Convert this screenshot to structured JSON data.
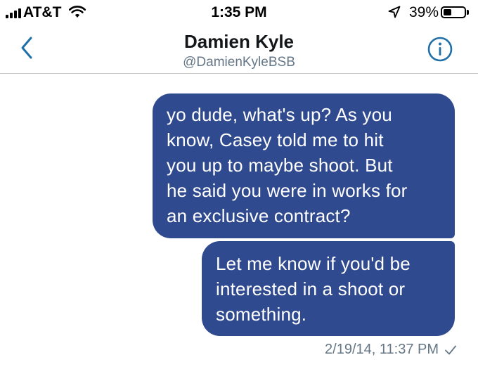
{
  "status_bar": {
    "carrier": "AT&T",
    "time": "1:35 PM",
    "battery_percent": "39%",
    "battery_level": 0.39,
    "icons": [
      "signal-bars-icon",
      "wifi-icon",
      "location-arrow-icon",
      "battery-icon"
    ]
  },
  "header": {
    "contact_name": "Damien Kyle",
    "contact_handle": "@DamienKyleBSB",
    "back_icon": "chevron-left-icon",
    "info_icon": "info-circle-icon"
  },
  "messages": [
    {
      "direction": "outgoing",
      "lines": [
        "yo dude, what's up? As you",
        "know, Casey told me to hit",
        "you up to maybe shoot. But",
        "he said you were in works for",
        "an exclusive contract?"
      ]
    },
    {
      "direction": "outgoing",
      "lines": [
        "Let me know if you'd be",
        "interested in a shoot or",
        "something."
      ]
    }
  ],
  "timestamp": "2/19/14, 11:37 PM",
  "read_icon": "checkmark-icon",
  "colors": {
    "bubble": "#304a8f",
    "accent": "#1f6fa8",
    "muted_text": "#657786"
  }
}
